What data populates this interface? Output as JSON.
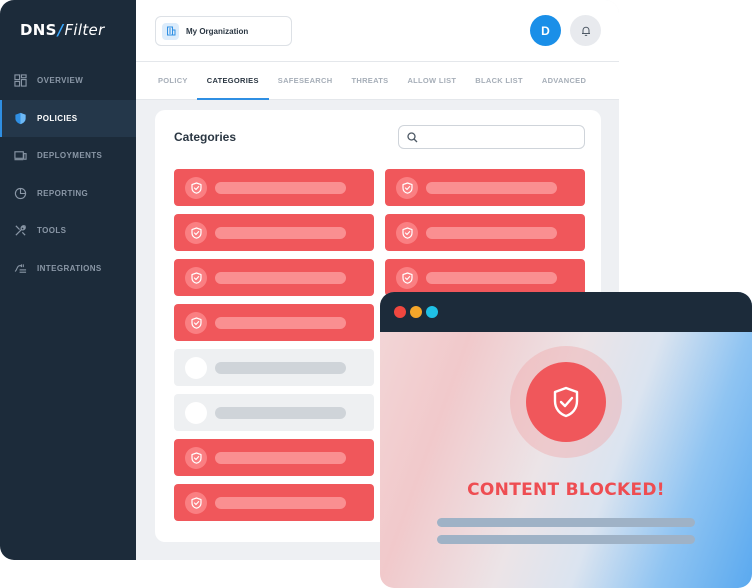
{
  "logo": {
    "left": "DNS",
    "right": "Filter"
  },
  "sidebar": {
    "items": [
      {
        "label": "OVERVIEW",
        "icon": "grid-icon",
        "active": false
      },
      {
        "label": "POLICIES",
        "icon": "shield-icon",
        "active": true
      },
      {
        "label": "DEPLOYMENTS",
        "icon": "devices-icon",
        "active": false
      },
      {
        "label": "REPORTING",
        "icon": "pie-chart-icon",
        "active": false
      },
      {
        "label": "TOOLS",
        "icon": "tools-icon",
        "active": false
      },
      {
        "label": "INTEGRATIONS",
        "icon": "plug-icon",
        "active": false
      }
    ]
  },
  "header": {
    "organization": "My Organization",
    "avatar_initial": "D"
  },
  "tabs": [
    "POLICY",
    "CATEGORIES",
    "SAFESEARCH",
    "THREATS",
    "ALLOW LIST",
    "BLACK LIST",
    "ADVANCED"
  ],
  "active_tab": "CATEGORIES",
  "panel": {
    "title": "Categories",
    "search_value": ""
  },
  "categories": {
    "left": [
      "blocked",
      "blocked",
      "blocked",
      "blocked",
      "allowed",
      "allowed",
      "blocked",
      "blocked"
    ],
    "right": [
      "blocked",
      "blocked",
      "blocked"
    ]
  },
  "popup": {
    "message": "CONTENT BLOCKED!"
  },
  "colors": {
    "sidebar": "#1c2b3a",
    "accent": "#2f8fe3",
    "blocked": "#f0575b",
    "allowed": "#eef0f2",
    "dot_red": "#f0473f",
    "dot_yellow": "#f4a62a",
    "dot_teal": "#1fc1e6"
  }
}
